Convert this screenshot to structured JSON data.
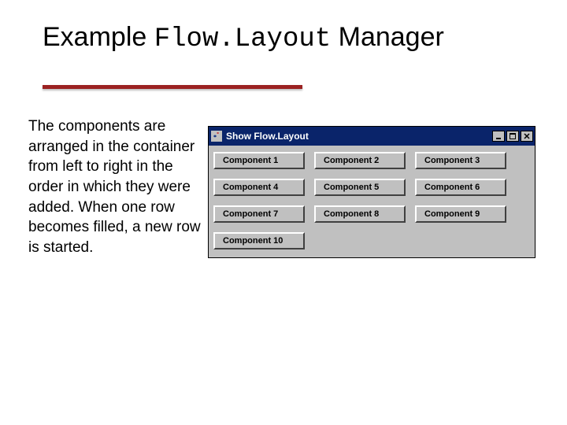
{
  "slide": {
    "title_prefix": "Example ",
    "title_mono": "Flow.Layout",
    "title_suffix": " Manager",
    "body": "The components are arranged in the container from left to right in the order in which they were added. When one row becomes filled, a new row is started."
  },
  "window": {
    "caption": "Show Flow.Layout",
    "buttons": [
      "Component 1",
      "Component 2",
      "Component 3",
      "Component 4",
      "Component 5",
      "Component 6",
      "Component 7",
      "Component 8",
      "Component 9",
      "Component 10"
    ]
  }
}
